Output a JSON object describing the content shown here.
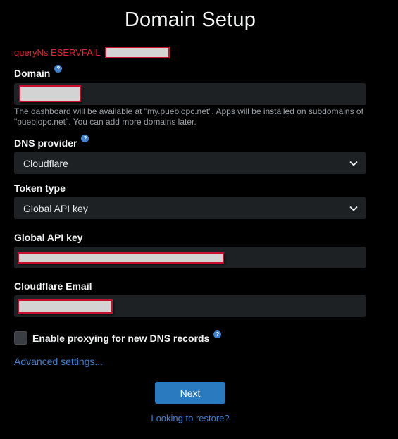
{
  "page": {
    "title": "Domain Setup"
  },
  "error": {
    "message": "queryNs ESERVFAIL"
  },
  "domain": {
    "label": "Domain",
    "help_icon": "question-circle-icon",
    "hint": "The dashboard will be available at \"my.pueblopc.net\". Apps will be installed on subdomains of \"pueblopc.net\". You can add more domains later."
  },
  "dns_provider": {
    "label": "DNS provider",
    "help_icon": "question-circle-icon",
    "selected": "Cloudflare"
  },
  "token_type": {
    "label": "Token type",
    "selected": "Global API key"
  },
  "api_key": {
    "label": "Global API key"
  },
  "email": {
    "label": "Cloudflare Email"
  },
  "proxying": {
    "label": "Enable proxying for new DNS records",
    "checked": false,
    "help_icon": "question-circle-icon"
  },
  "links": {
    "advanced": "Advanced settings...",
    "restore": "Looking to restore?"
  },
  "actions": {
    "next_label": "Next"
  },
  "colors": {
    "background": "#000000",
    "field_bg": "#1e2124",
    "accent": "#2a7abf",
    "link": "#3b82d6",
    "error": "#e5242b"
  }
}
